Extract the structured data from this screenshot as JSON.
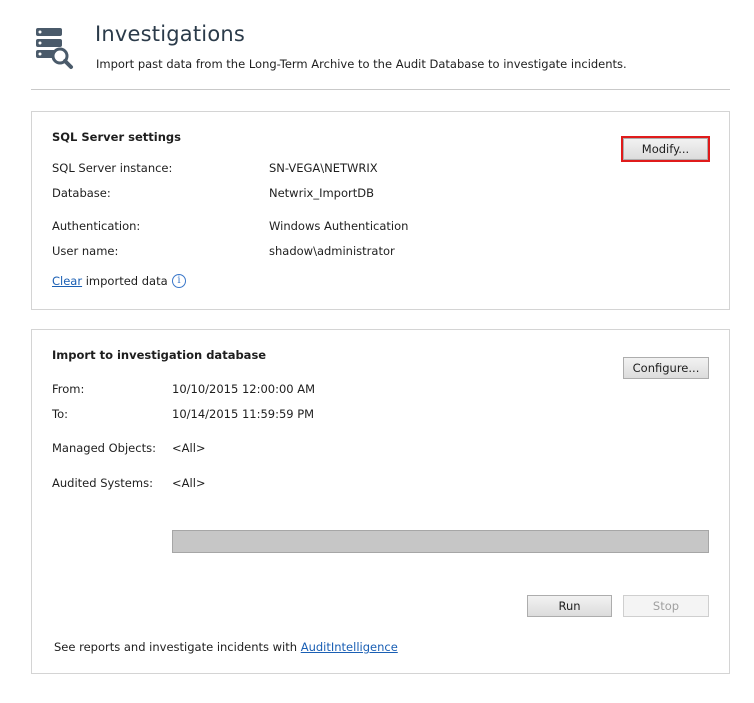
{
  "header": {
    "title": "Investigations",
    "subtitle": "Import past data from the Long-Term Archive to the Audit Database to investigate incidents.",
    "icon": "database-search-icon"
  },
  "sql_settings": {
    "title": "SQL Server settings",
    "modify_label": "Modify...",
    "fields": {
      "instance_label": "SQL Server instance:",
      "instance_value": "SN-VEGA\\NETWRIX",
      "database_label": "Database:",
      "database_value": "Netwrix_ImportDB",
      "auth_label": "Authentication:",
      "auth_value": "Windows Authentication",
      "user_label": "User name:",
      "user_value": "shadow\\administrator"
    },
    "clear_link": "Clear",
    "clear_text": "imported data",
    "info_icon": "i"
  },
  "import": {
    "title": "Import to investigation database",
    "configure_label": "Configure...",
    "fields": {
      "from_label": "From:",
      "from_value": "10/10/2015 12:00:00 AM",
      "to_label": "To:",
      "to_value": "10/14/2015 11:59:59 PM",
      "objects_label": "Managed Objects:",
      "objects_value": "<All>",
      "systems_label": "Audited Systems:",
      "systems_value": "<All>"
    },
    "progress": 0,
    "run_label": "Run",
    "stop_label": "Stop",
    "footer_text": "See reports and investigate incidents with",
    "footer_link": "AuditIntelligence"
  }
}
